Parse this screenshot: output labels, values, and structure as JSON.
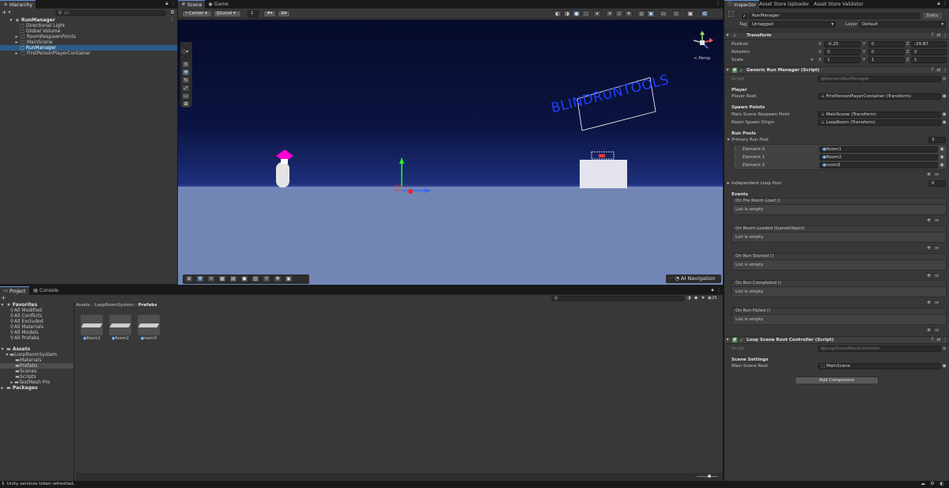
{
  "hierarchy": {
    "tab": "Hierarchy",
    "search_placeholder": "All",
    "root": "RunManager",
    "items": [
      "Directional Light",
      "Global Volume",
      "RoomRespawnPoints",
      "MainScene",
      "RunManager",
      "FirstPersonPlayerContainer"
    ]
  },
  "scene": {
    "tabs": [
      "Scene",
      "Game"
    ],
    "pivot": "Center",
    "space": "Local",
    "grid_value": "1",
    "persp_label": "< Persp",
    "ai_nav": "AI Navigation",
    "sign_text": "BLINDRUNTOOLS"
  },
  "project": {
    "tabs": [
      "Project",
      "Console"
    ],
    "count": "25",
    "favorites_label": "Favorites",
    "favorites": [
      "All Modified",
      "All Conflicts",
      "All Excluded",
      "All Materials",
      "All Models",
      "All Prefabs"
    ],
    "assets_label": "Assets",
    "tree": [
      "LoopRoomSystem",
      "Materials",
      "Prefabs",
      "Scenes",
      "Scripts",
      "TextMesh Pro"
    ],
    "packages_label": "Packages",
    "breadcrumb": [
      "Assets",
      "LoopRoomSystem",
      "Prefabs"
    ],
    "files": [
      "Room1",
      "Room2",
      "room3"
    ]
  },
  "status": {
    "message": "Unity services token refreshed."
  },
  "inspector": {
    "tabs": [
      "Inspector",
      "Asset Store Uploader",
      "Asset Store Validator"
    ],
    "object_name": "RunManager",
    "static_label": "Static",
    "tag_label": "Tag",
    "tag_value": "Untagged",
    "layer_label": "Layer",
    "layer_value": "Default",
    "transform": {
      "title": "Transform",
      "position_label": "Position",
      "rotation_label": "Rotation",
      "scale_label": "Scale",
      "axis_x": "X",
      "axis_y": "Y",
      "axis_z": "Z",
      "pos": [
        "-0.25",
        "0",
        "-29.87"
      ],
      "rot": [
        "0",
        "0",
        "0"
      ],
      "scale": [
        "1",
        "1",
        "1"
      ]
    },
    "grm": {
      "title": "Generic Run Manager (Script)",
      "script_label": "Script",
      "script_value": "GenericRunManager",
      "player_header": "Player",
      "player_root_label": "Player Root",
      "player_root_value": "FirstPersonPlayerContainer (Transform)",
      "spawn_header": "Spawn Points",
      "main_spawn_label": "Main Scene Respawn Point",
      "main_spawn_value": "MainScene (Transform)",
      "room_origin_label": "Room Spawn Origin",
      "room_origin_value": "LoopRoom (Transform)",
      "run_pools_header": "Run Pools",
      "primary_pool_label": "Primary Run Pool",
      "primary_pool_count": "3",
      "elements": [
        {
          "label": "Element 0",
          "value": "Room1"
        },
        {
          "label": "Element 1",
          "value": "Room2"
        },
        {
          "label": "Element 2",
          "value": "room3"
        }
      ],
      "independent_label": "Independent Loop Pool",
      "independent_count": "0",
      "events_header": "Events",
      "events": [
        "On Pre Room Load ()",
        "On Room Loaded (GameObject)",
        "On Run Started ()",
        "On Run Completed ()",
        "On Run Failed ()"
      ],
      "list_empty": "List is empty"
    },
    "lsrc": {
      "title": "Loop Scene Root Controller (Script)",
      "script_label": "Script",
      "script_value": "LoopSceneRootController",
      "settings_header": "Scene Settings",
      "root_label": "Main Scene Root",
      "root_value": "MainScene"
    },
    "add_component": "Add Component"
  },
  "colors": {
    "accent": "#2c5d87",
    "sky_top": "#060b2a",
    "ground": "#6f84b3",
    "magenta": "#ff00d4",
    "sign_text": "#1f3fff"
  }
}
